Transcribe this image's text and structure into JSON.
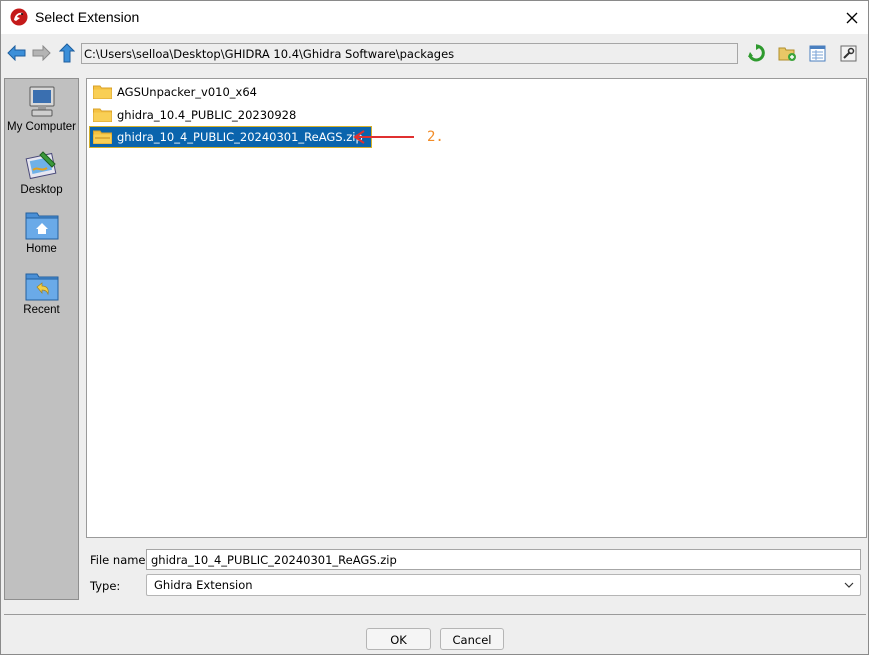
{
  "window": {
    "title": "Select Extension"
  },
  "toolbar": {
    "path": "C:\\Users\\selloa\\Desktop\\GHIDRA 10.4\\Ghidra Software\\packages",
    "icons": [
      "back-arrow-icon",
      "forward-arrow-icon",
      "up-arrow-icon",
      "refresh-icon",
      "new-folder-icon",
      "details-view-icon",
      "properties-icon"
    ]
  },
  "sidebar": {
    "items": [
      {
        "label": "My Computer",
        "icon": "computer-icon"
      },
      {
        "label": "Desktop",
        "icon": "desktop-icon"
      },
      {
        "label": "Home",
        "icon": "home-icon"
      },
      {
        "label": "Recent",
        "icon": "recent-icon"
      }
    ]
  },
  "files": [
    {
      "name": "AGSUnpacker_v010_x64",
      "selected": false
    },
    {
      "name": "ghidra_10.4_PUBLIC_20230928",
      "selected": false
    },
    {
      "name": "ghidra_10_4_PUBLIC_20240301_ReAGS.zip",
      "selected": true
    }
  ],
  "annotation": {
    "label": "2.",
    "color": "#f28c28",
    "arrow_color": "#e03030"
  },
  "fields": {
    "file_name_label": "File name:",
    "file_name_value": "ghidra_10_4_PUBLIC_20240301_ReAGS.zip",
    "type_label": "Type:",
    "type_value": "Ghidra Extension"
  },
  "buttons": {
    "ok": "OK",
    "cancel": "Cancel"
  },
  "colors": {
    "selection": "#0a64ad",
    "sidebar": "#c0c0c0",
    "folder": "#f5c242"
  }
}
